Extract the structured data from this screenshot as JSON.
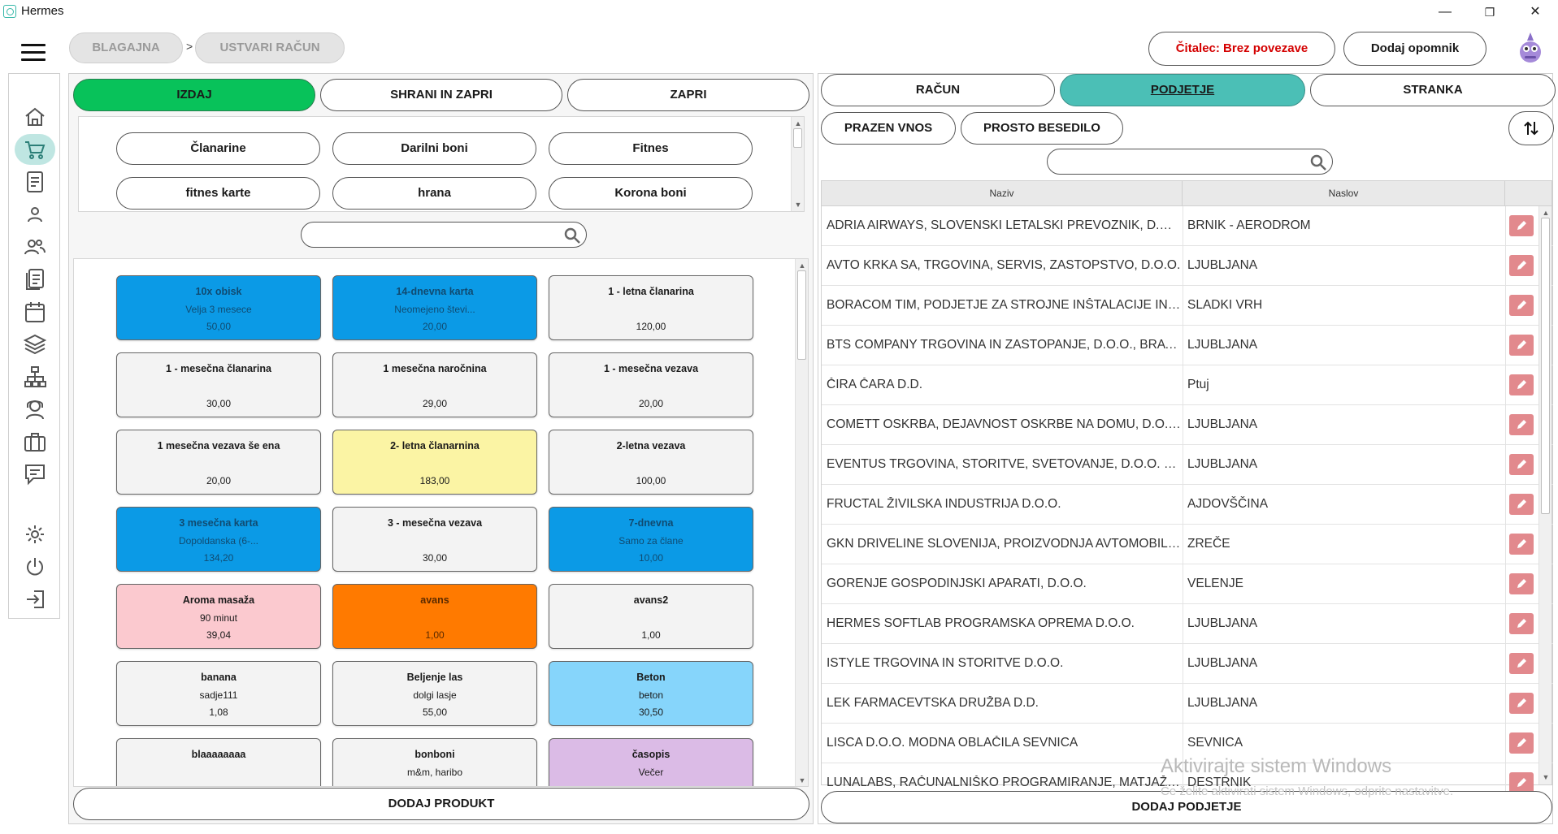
{
  "window": {
    "title": "Hermes",
    "minimize": "—",
    "restore": "❐",
    "close": "✕"
  },
  "breadcrumb": [
    {
      "label": "BLAGAJNA"
    },
    {
      "label": "USTVARI RAČUN"
    }
  ],
  "breadcrumb_sep": ">",
  "header": {
    "reader_status": "Čitalec: Brez povezave",
    "reader_color": "#d40000",
    "add_reminder": "Dodaj opomnik"
  },
  "left_actions": {
    "issue": "IZDAJ",
    "save_close": "SHRANI IN ZAPRI",
    "close": "ZAPRI"
  },
  "categories": [
    "Članarine",
    "Darilni boni",
    "Fitnes",
    "fitnes karte",
    "hrana",
    "Korona boni"
  ],
  "products": [
    {
      "name": "10x obisk",
      "desc": "Velja 3 mesece",
      "price": "50,00",
      "color": "blue"
    },
    {
      "name": "14-dnevna karta",
      "desc": "Neomejeno števi...",
      "price": "20,00",
      "color": "blue"
    },
    {
      "name": "1 - letna članarina",
      "desc": "",
      "price": "120,00",
      "color": "white"
    },
    {
      "name": "1 - mesečna članarina",
      "desc": "",
      "price": "30,00",
      "color": "white"
    },
    {
      "name": "1 mesečna naročnina",
      "desc": "",
      "price": "29,00",
      "color": "white"
    },
    {
      "name": "1 - mesečna vezava",
      "desc": "",
      "price": "20,00",
      "color": "white"
    },
    {
      "name": "1 mesečna vezava še ena",
      "desc": "",
      "price": "20,00",
      "color": "white"
    },
    {
      "name": "2- letna članarnina",
      "desc": "",
      "price": "183,00",
      "color": "yellow"
    },
    {
      "name": "2-letna vezava",
      "desc": "",
      "price": "100,00",
      "color": "white"
    },
    {
      "name": "3 mesečna karta",
      "desc": "Dopoldanska (6-...",
      "price": "134,20",
      "color": "blue"
    },
    {
      "name": "3 - mesečna vezava",
      "desc": "",
      "price": "30,00",
      "color": "white"
    },
    {
      "name": "7-dnevna",
      "desc": "Samo za člane",
      "price": "10,00",
      "color": "blue"
    },
    {
      "name": "Aroma masaža",
      "desc": "90 minut",
      "price": "39,04",
      "color": "pink"
    },
    {
      "name": "avans",
      "desc": "",
      "price": "1,00",
      "color": "orange"
    },
    {
      "name": "avans2",
      "desc": "",
      "price": "1,00",
      "color": "white"
    },
    {
      "name": "banana",
      "desc": "sadje111",
      "price": "1,08",
      "color": "white"
    },
    {
      "name": "Beljenje las",
      "desc": "dolgi lasje",
      "price": "55,00",
      "color": "white"
    },
    {
      "name": "Beton",
      "desc": "beton",
      "price": "30,50",
      "color": "lightblue"
    },
    {
      "name": "blaaaaaaaa",
      "desc": "",
      "price": "",
      "color": "white"
    },
    {
      "name": "bonboni",
      "desc": "m&m, haribo",
      "price": "",
      "color": "white"
    },
    {
      "name": "časopis",
      "desc": "Večer",
      "price": "",
      "color": "purple"
    }
  ],
  "add_product": "DODAJ PRODUKT",
  "right_tabs": {
    "invoice": "RAČUN",
    "company": "PODJETJE",
    "customer": "STRANKA"
  },
  "right_actions": {
    "empty_entry": "PRAZEN VNOS",
    "free_text": "PROSTO BESEDILO"
  },
  "table": {
    "headers": [
      "Naziv",
      "Naslov"
    ],
    "rows": [
      [
        "ADRIA AIRWAYS, SLOVENSKI LETALSKI PREVOZNIK, D.O.O. - ...",
        "BRNIK - AERODROM"
      ],
      [
        "AVTO KRKA SA, TRGOVINA, SERVIS, ZASTOPSTVO, D.O.O.",
        "LJUBLJANA"
      ],
      [
        "BORACOM TIM, PODJETJE ZA STROJNE INŠTALACIJE IN ZAKLJ...",
        "SLADKI VRH"
      ],
      [
        "BTS COMPANY TRGOVINA IN ZASTOPANJE, D.O.O., BRATISL...",
        "LJUBLJANA"
      ],
      [
        "ČIRA ČARA D.D.",
        "Ptuj"
      ],
      [
        "COMETT OSKRBA, DEJAVNOST OSKRBE NA DOMU, D.O.O.",
        "LJUBLJANA"
      ],
      [
        "EVENTUS TRGOVINA, STORITVE, SVETOVANJE, D.O.O. LJUBLJ...",
        "LJUBLJANA"
      ],
      [
        "FRUCTAL ŽIVILSKA INDUSTRIJA D.O.O.",
        "AJDOVŠČINA"
      ],
      [
        "GKN DRIVELINE SLOVENIJA, PROIZVODNJA AVTOMOBILSKIH...",
        "ZREČE"
      ],
      [
        "GORENJE GOSPODINJSKI APARATI, D.O.O.",
        "VELENJE"
      ],
      [
        "HERMES SOFTLAB PROGRAMSKA OPREMA D.O.O.",
        "LJUBLJANA"
      ],
      [
        "ISTYLE TRGOVINA IN STORITVE D.O.O.",
        "LJUBLJANA"
      ],
      [
        "LEK FARMACEVTSKA DRUŽBA D.D.",
        "LJUBLJANA"
      ],
      [
        "LISCA D.O.O. MODNA OBLAČILA SEVNICA",
        "SEVNICA"
      ],
      [
        "LUNALABS, RAČUNALNIŠKO PROGRAMIRANJE, MATJAŽ KRA...",
        "DESTRNIK"
      ]
    ]
  },
  "add_company": "DODAJ PODJETJE",
  "watermark": {
    "line1": "Aktivirajte sistem Windows",
    "line2": "Če želite aktivirati sistem Windows, odprite nastavitve."
  },
  "colors": {
    "green": "#08c25a",
    "teal": "#4bbfb6",
    "blue": "#0b9ae6",
    "yellow": "#fbf4a4",
    "pink": "#fbc9cf",
    "orange": "#ff7a00",
    "lightblue": "#86d5fb",
    "purple": "#dbbbe6",
    "edit": "#e2898d"
  },
  "sidebar_icons": [
    "home-icon",
    "cart-icon",
    "document-icon",
    "user-icon",
    "users-icon",
    "list-icon",
    "calendar-icon",
    "layers-icon",
    "network-icon",
    "support-icon",
    "briefcase-icon",
    "message-icon",
    "gear-icon",
    "power-icon",
    "logout-icon"
  ]
}
